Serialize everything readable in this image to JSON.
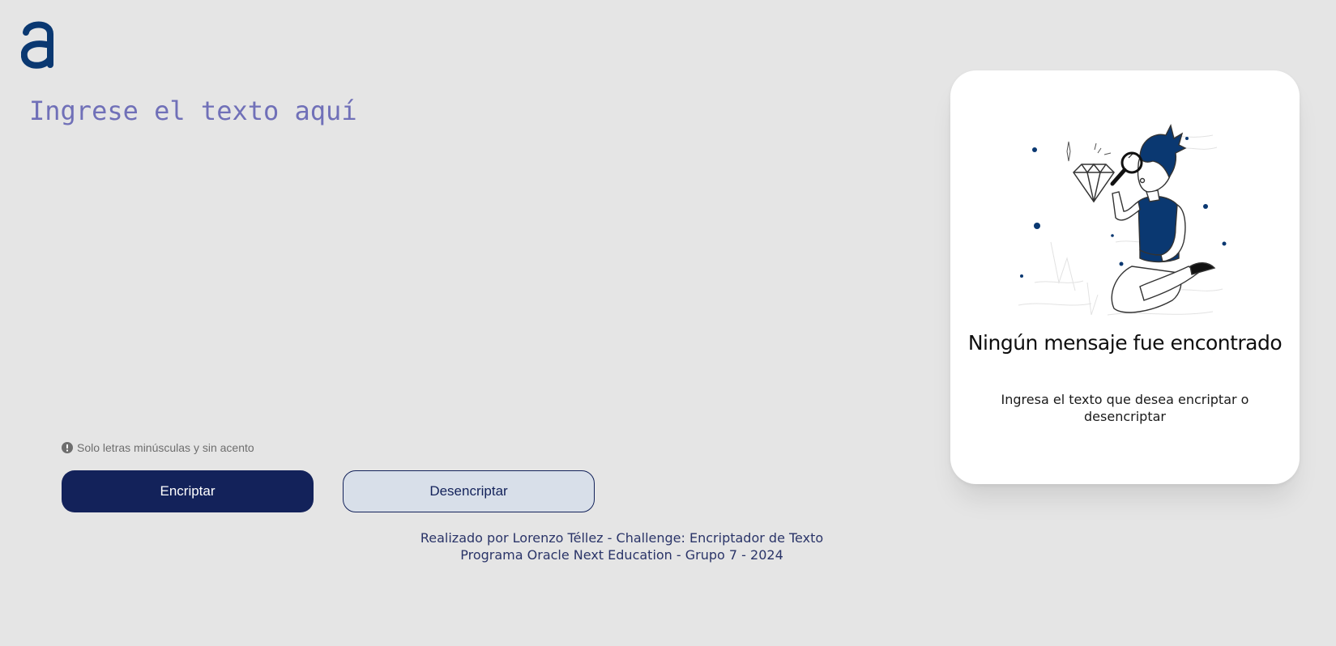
{
  "input": {
    "placeholder": "Ingrese el texto aquí"
  },
  "hint": {
    "icon": "exclamation-circle-icon",
    "text": "Solo letras minúsculas y sin acento"
  },
  "buttons": {
    "encrypt_label": "Encriptar",
    "decrypt_label": "Desencriptar"
  },
  "footer": {
    "line1": "Realizado por Lorenzo Téllez - Challenge: Encriptador de Texto",
    "line2": "Programa Oracle Next Education - Grupo 7 - 2024"
  },
  "result_card": {
    "illustration": "person-searching-magnifier-illustration",
    "title": "Ningún mensaje fue encontrado",
    "subtitle": "Ingresa el texto que desea encriptar o desencriptar"
  },
  "colors": {
    "background": "#e5e5e5",
    "primary": "#13225a",
    "brand": "#0a3871",
    "placeholder": "#7070b8",
    "secondary_button": "#d8dfe9"
  }
}
